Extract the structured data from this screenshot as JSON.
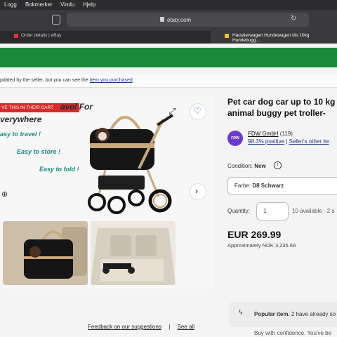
{
  "menubar": {
    "items": [
      "Logg",
      "Bokmerker",
      "Vindu",
      "Hjelp"
    ]
  },
  "browser": {
    "url": "ebay.com",
    "tabs": [
      {
        "label": "Order details | eBay"
      },
      {
        "label": "Haustierwagen Hundewagen bis 10kg Hundebugg..."
      }
    ]
  },
  "notice": {
    "prefix": "pdated by the seller, but you can see the ",
    "link": "item you purchased",
    "suffix": "."
  },
  "gallery": {
    "cart_badge": "VE THIS IN THEIR CART",
    "headline_1": "avel For",
    "headline_2": "verywhere",
    "promo_1": "asy to travel !",
    "promo_2": "Easy to store !",
    "promo_3": "Easy to fold !"
  },
  "listing": {
    "title_1": "Pet car dog car up to 10 kg",
    "title_2": "animal buggy pet troller-",
    "seller": {
      "logo_text": "FDW",
      "name": "FDW GmbH",
      "count": "(119)",
      "positive": "98.3% positive",
      "other_link": "Seller's other ite"
    },
    "condition_label": "Condition:",
    "condition_value": "New",
    "farbe_label": "Farbe:",
    "farbe_value": "D8 Schwarz",
    "quantity_label": "Quantity:",
    "quantity_value": "1",
    "available": "10 available · 2 s",
    "price": "EUR 269.99",
    "approx": "Approximately NOK 3,235.68",
    "popular_bold": "Popular item.",
    "popular_rest": " 2 have already so",
    "buy_conf": "Buy with confidence. You've be"
  },
  "footer": {
    "feedback": "Feedback on our suggestions",
    "sep": "|",
    "see_all": "See all"
  },
  "colors": {
    "green_bar": "#1a8a3a",
    "badge": "#d52b2b",
    "promo": "#1a8a80",
    "seller": "#6b3bd1"
  }
}
